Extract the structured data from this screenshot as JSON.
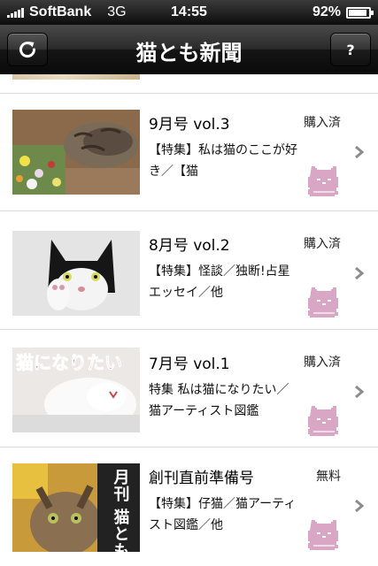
{
  "status_bar": {
    "carrier": "SoftBank",
    "network": "3G",
    "time": "14:55",
    "battery_text": "92%",
    "battery_level": 0.92
  },
  "nav": {
    "title": "猫とも新聞",
    "refresh_icon": "refresh-icon",
    "help_label": "?"
  },
  "issues": [
    {
      "title": "9月号 vol.3",
      "status": "購入済",
      "summary": "【特集】私は猫のここが好き／【猫"
    },
    {
      "title": "8月号 vol.2",
      "status": "購入済",
      "summary": "【特集】怪談／独断!占星エッセイ／他"
    },
    {
      "title": "7月号 vol.1",
      "status": "購入済",
      "summary": "特集 私は猫になりたい／猫アーティスト図鑑",
      "thumb_caption": "猫になりたい"
    },
    {
      "title": "創刊直前準備号",
      "status": "無料",
      "summary": "【特集】仔猫／猫アーティスト図鑑／他",
      "thumb_caption": "月刊 猫とも新"
    }
  ],
  "colors": {
    "cat_badge": "#d9a6c6",
    "chevron": "#8c8c8c",
    "separator": "#d9d9d9"
  }
}
